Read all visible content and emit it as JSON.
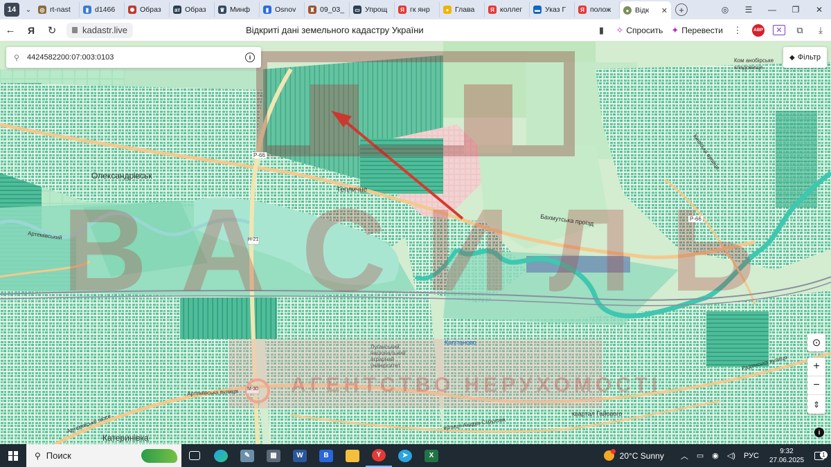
{
  "browser": {
    "tab_count": "14",
    "tabs": [
      {
        "label": "rt-nast",
        "fav_color": "#8a6d3b",
        "glyph": "◎"
      },
      {
        "label": "d1466",
        "fav_color": "#3a7bd5",
        "glyph": "▮"
      },
      {
        "label": "Образ",
        "fav_color": "#c0392b",
        "glyph": "✺"
      },
      {
        "label": "Образ",
        "fav_color": "#2c3e50",
        "glyph": "ат"
      },
      {
        "label": "Минф",
        "fav_color": "#34495e",
        "glyph": "♛"
      },
      {
        "label": "Osnov",
        "fav_color": "#2d6cdf",
        "glyph": "▮"
      },
      {
        "label": "09_03_",
        "fav_color": "#a0522d",
        "glyph": "♜"
      },
      {
        "label": "Упрощ",
        "fav_color": "#2c3e50",
        "glyph": "▭"
      },
      {
        "label": "гк янр",
        "fav_color": "#e53935",
        "glyph": "Я"
      },
      {
        "label": "Глава",
        "fav_color": "#f0b400",
        "glyph": "●"
      },
      {
        "label": "коллег",
        "fav_color": "#e53935",
        "glyph": "Я"
      },
      {
        "label": "Указ Г",
        "fav_color": "#1565c0",
        "glyph": "▬"
      },
      {
        "label": "полож",
        "fav_color": "#e53935",
        "glyph": "Я"
      }
    ],
    "active_tab": {
      "label": "Відк",
      "fav_color": "#7a8f5a",
      "glyph": "●"
    },
    "url": "kadastr.live",
    "page_title": "Відкриті дані земельного кадастру України",
    "ask_label": "Спросить",
    "translate_label": "Перевести",
    "abp_label": "ABP"
  },
  "map": {
    "search_value": "4424582200:07:003:0103",
    "filter_label": "Фільтр",
    "places": {
      "oleksandrivsk": "Олександрівськ",
      "katerynivka": "Катеринівка",
      "teplychne": "Тепличне",
      "kapitanovo": "Капітаново",
      "kvartal_haiovoho": "квартал Гайового",
      "cemetery": "Ком анобірське кладовище",
      "university": "Луганський національний аграрний університет",
      "kapitanove_sm": "Капітанове",
      "oleksandrivka_hint": "Олександрівськ"
    },
    "roads": {
      "r66_left": "Р-66",
      "r66_right": "Р-66",
      "n21": "Н-21",
      "m30": "М-30",
      "bakhmutska": "Бахмутська проїзд",
      "artemivsky_left": "Артемівський",
      "artemivska_st": "Артемівська вулиця",
      "artemivske_sh": "Артемівське шосе",
      "sovetska": "Радянська вулиця",
      "kyivska": "Київська вулиця",
      "andriia_struhova": "вулиця Андрія Струхова",
      "kulturna": "Культурна"
    },
    "watermark_big": "ВАСИЛЬ",
    "watermark_small": "АГЕНТСТВО НЕРУХОМОСТІ",
    "colors": {
      "parcel": "#5fc6a4",
      "parcel_dark": "#2f9b7b",
      "river": "#3fc7b0",
      "road": "#f3c98e",
      "background": "#d4ecd0"
    }
  },
  "taskbar": {
    "search_label": "Поиск",
    "weather": "20°C  Sunny",
    "language": "РУС",
    "time": "9:32",
    "date": "27.06.2025",
    "notifications": "1"
  }
}
